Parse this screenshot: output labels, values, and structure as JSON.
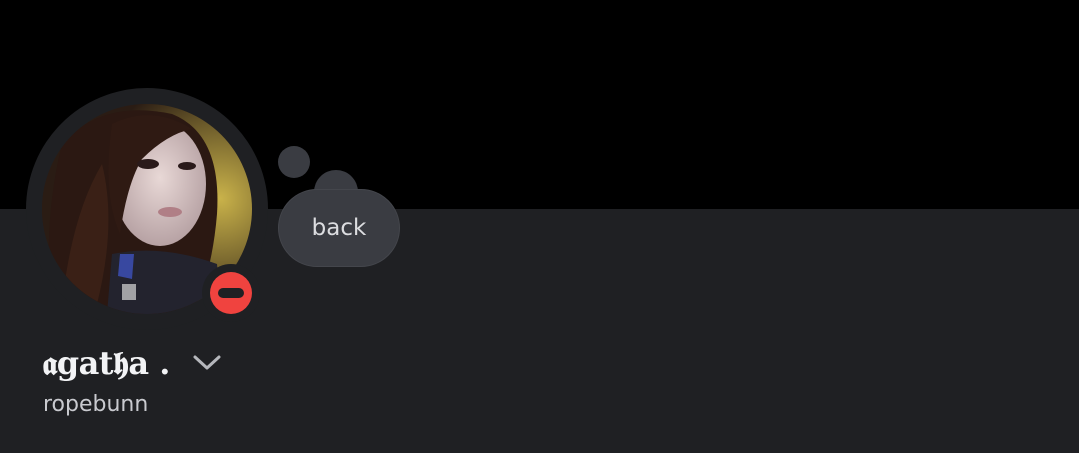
{
  "profile": {
    "display_name": "𝖆gat𝖍a .",
    "username": "ropebunn",
    "custom_status": "back",
    "status": "do-not-disturb",
    "avatar_description": "profile photo",
    "status_icon": "do-not-disturb-icon",
    "expand_icon": "chevron-down-icon"
  },
  "colors": {
    "banner": "#000000",
    "background": "#1f2023",
    "bubble": "#3a3c42",
    "dnd_red": "#f0433f",
    "text_primary": "#f2f3f5",
    "text_secondary": "#c9cacf"
  }
}
